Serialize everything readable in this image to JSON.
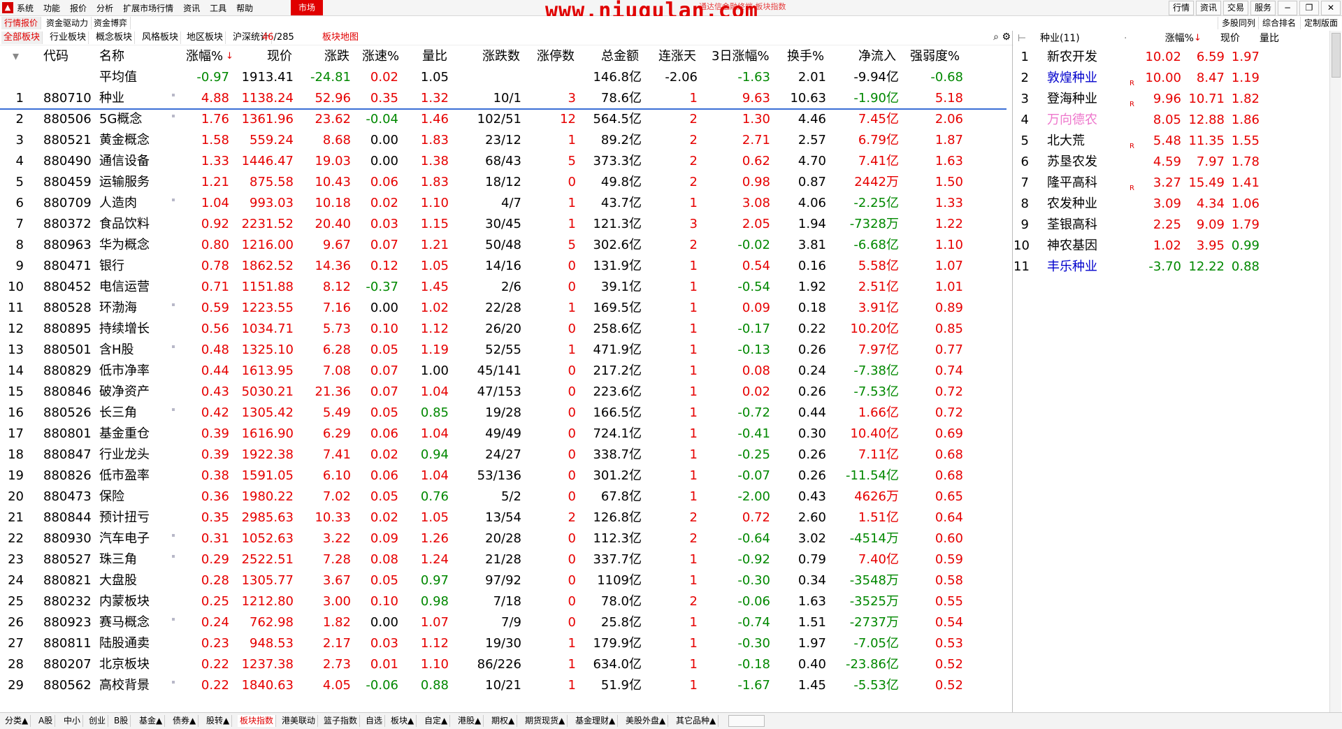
{
  "menubar": {
    "logo": "▲",
    "items": [
      "系统",
      "功能",
      "报价",
      "分析",
      "扩展市场行情",
      "资讯",
      "工具",
      "帮助"
    ],
    "market_button": "市场",
    "watermark": "www.niugulan.com",
    "watermark_sub": "通达信金融终端 板块指数",
    "right_items": [
      "行情",
      "资讯",
      "交易",
      "服务"
    ]
  },
  "tabs_top": [
    "行情报价",
    "资金驱动力",
    "资金博弈"
  ],
  "tabs_top_right": [
    "多股同列",
    "综合排名",
    "定制版面"
  ],
  "tabs_second": [
    "全部板块",
    "行业板块",
    "概念板块",
    "风格板块",
    "地区板块",
    "沪深统计"
  ],
  "counter": {
    "current": "46",
    "total": "/285"
  },
  "map_link": "板块地图",
  "main_table": {
    "headers": [
      "代码",
      "名称",
      "涨幅%",
      "现价",
      "涨跌",
      "涨速%",
      "量比",
      "涨跌数",
      "涨停数",
      "总金额",
      "连涨天",
      "3日涨幅%",
      "换手%",
      "净流入",
      "强弱度%"
    ],
    "average_row": {
      "label": "平均值",
      "chg_pct": "-0.97",
      "price": "1913.41",
      "chg": "-24.81",
      "speed": "0.02",
      "vol_ratio": "1.05",
      "amount": "146.8亿",
      "days": "-2.06",
      "three_day": "-1.63",
      "turnover": "2.01",
      "net_flow": "-9.94亿",
      "strength": "-0.68"
    },
    "rows": [
      {
        "idx": "1",
        "code": "880710",
        "name": "种业",
        "dot": true,
        "chg_pct": "4.88",
        "price": "1138.24",
        "chg": "52.96",
        "speed": "0.35",
        "vol_ratio": "1.32",
        "updown": "10/1",
        "limit": "3",
        "amount": "78.6亿",
        "days": "1",
        "three_day": "9.63",
        "turnover": "10.63",
        "net_flow": "-1.90亿",
        "strength": "5.18"
      },
      {
        "idx": "2",
        "code": "880506",
        "name": "5G概念",
        "dot": true,
        "chg_pct": "1.76",
        "price": "1361.96",
        "chg": "23.62",
        "speed": "-0.04",
        "vol_ratio": "1.46",
        "updown": "102/51",
        "limit": "12",
        "amount": "564.5亿",
        "days": "2",
        "three_day": "1.30",
        "turnover": "4.46",
        "net_flow": "7.45亿",
        "strength": "2.06"
      },
      {
        "idx": "3",
        "code": "880521",
        "name": "黄金概念",
        "dot": false,
        "chg_pct": "1.58",
        "price": "559.24",
        "chg": "8.68",
        "speed": "0.00",
        "vol_ratio": "1.83",
        "updown": "23/12",
        "limit": "1",
        "amount": "89.2亿",
        "days": "2",
        "three_day": "2.71",
        "turnover": "2.57",
        "net_flow": "6.79亿",
        "strength": "1.87"
      },
      {
        "idx": "4",
        "code": "880490",
        "name": "通信设备",
        "dot": false,
        "chg_pct": "1.33",
        "price": "1446.47",
        "chg": "19.03",
        "speed": "0.00",
        "vol_ratio": "1.38",
        "updown": "68/43",
        "limit": "5",
        "amount": "373.3亿",
        "days": "2",
        "three_day": "0.62",
        "turnover": "4.70",
        "net_flow": "7.41亿",
        "strength": "1.63"
      },
      {
        "idx": "5",
        "code": "880459",
        "name": "运输服务",
        "dot": false,
        "chg_pct": "1.21",
        "price": "875.58",
        "chg": "10.43",
        "speed": "0.06",
        "vol_ratio": "1.83",
        "updown": "18/12",
        "limit": "0",
        "amount": "49.8亿",
        "days": "2",
        "three_day": "0.98",
        "turnover": "0.87",
        "net_flow": "2442万",
        "strength": "1.50"
      },
      {
        "idx": "6",
        "code": "880709",
        "name": "人造肉",
        "dot": true,
        "chg_pct": "1.04",
        "price": "993.03",
        "chg": "10.18",
        "speed": "0.02",
        "vol_ratio": "1.10",
        "updown": "4/7",
        "limit": "1",
        "amount": "43.7亿",
        "days": "1",
        "three_day": "3.08",
        "turnover": "4.06",
        "net_flow": "-2.25亿",
        "strength": "1.33"
      },
      {
        "idx": "7",
        "code": "880372",
        "name": "食品饮料",
        "dot": false,
        "chg_pct": "0.92",
        "price": "2231.52",
        "chg": "20.40",
        "speed": "0.03",
        "vol_ratio": "1.15",
        "updown": "30/45",
        "limit": "1",
        "amount": "121.3亿",
        "days": "3",
        "three_day": "2.05",
        "turnover": "1.94",
        "net_flow": "-7328万",
        "strength": "1.22"
      },
      {
        "idx": "8",
        "code": "880963",
        "name": "华为概念",
        "dot": false,
        "chg_pct": "0.80",
        "price": "1216.00",
        "chg": "9.67",
        "speed": "0.07",
        "vol_ratio": "1.21",
        "updown": "50/48",
        "limit": "5",
        "amount": "302.6亿",
        "days": "2",
        "three_day": "-0.02",
        "turnover": "3.81",
        "net_flow": "-6.68亿",
        "strength": "1.10"
      },
      {
        "idx": "9",
        "code": "880471",
        "name": "银行",
        "dot": false,
        "chg_pct": "0.78",
        "price": "1862.52",
        "chg": "14.36",
        "speed": "0.12",
        "vol_ratio": "1.05",
        "updown": "14/16",
        "limit": "0",
        "amount": "131.9亿",
        "days": "1",
        "three_day": "0.54",
        "turnover": "0.16",
        "net_flow": "5.58亿",
        "strength": "1.07"
      },
      {
        "idx": "10",
        "code": "880452",
        "name": "电信运营",
        "dot": false,
        "chg_pct": "0.71",
        "price": "1151.88",
        "chg": "8.12",
        "speed": "-0.37",
        "vol_ratio": "1.45",
        "updown": "2/6",
        "limit": "0",
        "amount": "39.1亿",
        "days": "1",
        "three_day": "-0.54",
        "turnover": "1.92",
        "net_flow": "2.51亿",
        "strength": "1.01"
      },
      {
        "idx": "11",
        "code": "880528",
        "name": "环渤海",
        "dot": true,
        "chg_pct": "0.59",
        "price": "1223.55",
        "chg": "7.16",
        "speed": "0.00",
        "vol_ratio": "1.02",
        "updown": "22/28",
        "limit": "1",
        "amount": "169.5亿",
        "days": "1",
        "three_day": "0.09",
        "turnover": "0.18",
        "net_flow": "3.91亿",
        "strength": "0.89"
      },
      {
        "idx": "12",
        "code": "880895",
        "name": "持续增长",
        "dot": false,
        "chg_pct": "0.56",
        "price": "1034.71",
        "chg": "5.73",
        "speed": "0.10",
        "vol_ratio": "1.12",
        "updown": "26/20",
        "limit": "0",
        "amount": "258.6亿",
        "days": "1",
        "three_day": "-0.17",
        "turnover": "0.22",
        "net_flow": "10.20亿",
        "strength": "0.85"
      },
      {
        "idx": "13",
        "code": "880501",
        "name": "含H股",
        "dot": true,
        "chg_pct": "0.48",
        "price": "1325.10",
        "chg": "6.28",
        "speed": "0.05",
        "vol_ratio": "1.19",
        "updown": "52/55",
        "limit": "1",
        "amount": "471.9亿",
        "days": "1",
        "three_day": "-0.13",
        "turnover": "0.26",
        "net_flow": "7.97亿",
        "strength": "0.77"
      },
      {
        "idx": "14",
        "code": "880829",
        "name": "低市净率",
        "dot": false,
        "chg_pct": "0.44",
        "price": "1613.95",
        "chg": "7.08",
        "speed": "0.07",
        "vol_ratio": "1.00",
        "updown": "45/141",
        "limit": "0",
        "amount": "217.2亿",
        "days": "1",
        "three_day": "0.08",
        "turnover": "0.24",
        "net_flow": "-7.38亿",
        "strength": "0.74"
      },
      {
        "idx": "15",
        "code": "880846",
        "name": "破净资产",
        "dot": false,
        "chg_pct": "0.43",
        "price": "5030.21",
        "chg": "21.36",
        "speed": "0.07",
        "vol_ratio": "1.04",
        "updown": "47/153",
        "limit": "0",
        "amount": "223.6亿",
        "days": "1",
        "three_day": "0.02",
        "turnover": "0.26",
        "net_flow": "-7.53亿",
        "strength": "0.72"
      },
      {
        "idx": "16",
        "code": "880526",
        "name": "长三角",
        "dot": true,
        "chg_pct": "0.42",
        "price": "1305.42",
        "chg": "5.49",
        "speed": "0.05",
        "vol_ratio": "0.85",
        "updown": "19/28",
        "limit": "0",
        "amount": "166.5亿",
        "days": "1",
        "three_day": "-0.72",
        "turnover": "0.44",
        "net_flow": "1.66亿",
        "strength": "0.72"
      },
      {
        "idx": "17",
        "code": "880801",
        "name": "基金重仓",
        "dot": false,
        "chg_pct": "0.39",
        "price": "1616.90",
        "chg": "6.29",
        "speed": "0.06",
        "vol_ratio": "1.04",
        "updown": "49/49",
        "limit": "0",
        "amount": "724.1亿",
        "days": "1",
        "three_day": "-0.41",
        "turnover": "0.30",
        "net_flow": "10.40亿",
        "strength": "0.69"
      },
      {
        "idx": "18",
        "code": "880847",
        "name": "行业龙头",
        "dot": false,
        "chg_pct": "0.39",
        "price": "1922.38",
        "chg": "7.41",
        "speed": "0.02",
        "vol_ratio": "0.94",
        "updown": "24/27",
        "limit": "0",
        "amount": "338.7亿",
        "days": "1",
        "three_day": "-0.25",
        "turnover": "0.26",
        "net_flow": "7.11亿",
        "strength": "0.68"
      },
      {
        "idx": "19",
        "code": "880826",
        "name": "低市盈率",
        "dot": false,
        "chg_pct": "0.38",
        "price": "1591.05",
        "chg": "6.10",
        "speed": "0.06",
        "vol_ratio": "1.04",
        "updown": "53/136",
        "limit": "0",
        "amount": "301.2亿",
        "days": "1",
        "three_day": "-0.07",
        "turnover": "0.26",
        "net_flow": "-11.54亿",
        "strength": "0.68"
      },
      {
        "idx": "20",
        "code": "880473",
        "name": "保险",
        "dot": false,
        "chg_pct": "0.36",
        "price": "1980.22",
        "chg": "7.02",
        "speed": "0.05",
        "vol_ratio": "0.76",
        "updown": "5/2",
        "limit": "0",
        "amount": "67.8亿",
        "days": "1",
        "three_day": "-2.00",
        "turnover": "0.43",
        "net_flow": "4626万",
        "strength": "0.65"
      },
      {
        "idx": "21",
        "code": "880844",
        "name": "预计扭亏",
        "dot": false,
        "chg_pct": "0.35",
        "price": "2985.63",
        "chg": "10.33",
        "speed": "0.02",
        "vol_ratio": "1.05",
        "updown": "13/54",
        "limit": "2",
        "amount": "126.8亿",
        "days": "2",
        "three_day": "0.72",
        "turnover": "2.60",
        "net_flow": "1.51亿",
        "strength": "0.64"
      },
      {
        "idx": "22",
        "code": "880930",
        "name": "汽车电子",
        "dot": true,
        "chg_pct": "0.31",
        "price": "1052.63",
        "chg": "3.22",
        "speed": "0.09",
        "vol_ratio": "1.26",
        "updown": "20/28",
        "limit": "0",
        "amount": "112.3亿",
        "days": "2",
        "three_day": "-0.64",
        "turnover": "3.02",
        "net_flow": "-4514万",
        "strength": "0.60"
      },
      {
        "idx": "23",
        "code": "880527",
        "name": "珠三角",
        "dot": true,
        "chg_pct": "0.29",
        "price": "2522.51",
        "chg": "7.28",
        "speed": "0.08",
        "vol_ratio": "1.24",
        "updown": "21/28",
        "limit": "0",
        "amount": "337.7亿",
        "days": "1",
        "three_day": "-0.92",
        "turnover": "0.79",
        "net_flow": "7.40亿",
        "strength": "0.59"
      },
      {
        "idx": "24",
        "code": "880821",
        "name": "大盘股",
        "dot": false,
        "chg_pct": "0.28",
        "price": "1305.77",
        "chg": "3.67",
        "speed": "0.05",
        "vol_ratio": "0.97",
        "updown": "97/92",
        "limit": "0",
        "amount": "1109亿",
        "days": "1",
        "three_day": "-0.30",
        "turnover": "0.34",
        "net_flow": "-3548万",
        "strength": "0.58"
      },
      {
        "idx": "25",
        "code": "880232",
        "name": "内蒙板块",
        "dot": false,
        "chg_pct": "0.25",
        "price": "1212.80",
        "chg": "3.00",
        "speed": "0.10",
        "vol_ratio": "0.98",
        "updown": "7/18",
        "limit": "0",
        "amount": "78.0亿",
        "days": "2",
        "three_day": "-0.06",
        "turnover": "1.63",
        "net_flow": "-3525万",
        "strength": "0.55"
      },
      {
        "idx": "26",
        "code": "880923",
        "name": "赛马概念",
        "dot": true,
        "chg_pct": "0.24",
        "price": "762.98",
        "chg": "1.82",
        "speed": "0.00",
        "vol_ratio": "1.07",
        "updown": "7/9",
        "limit": "0",
        "amount": "25.8亿",
        "days": "1",
        "three_day": "-0.74",
        "turnover": "1.51",
        "net_flow": "-2737万",
        "strength": "0.54"
      },
      {
        "idx": "27",
        "code": "880811",
        "name": "陆股通卖",
        "dot": false,
        "chg_pct": "0.23",
        "price": "948.53",
        "chg": "2.17",
        "speed": "0.03",
        "vol_ratio": "1.12",
        "updown": "19/30",
        "limit": "1",
        "amount": "179.9亿",
        "days": "1",
        "three_day": "-0.30",
        "turnover": "1.97",
        "net_flow": "-7.05亿",
        "strength": "0.53"
      },
      {
        "idx": "28",
        "code": "880207",
        "name": "北京板块",
        "dot": false,
        "chg_pct": "0.22",
        "price": "1237.38",
        "chg": "2.73",
        "speed": "0.01",
        "vol_ratio": "1.10",
        "updown": "86/226",
        "limit": "1",
        "amount": "634.0亿",
        "days": "1",
        "three_day": "-0.18",
        "turnover": "0.40",
        "net_flow": "-23.86亿",
        "strength": "0.52"
      },
      {
        "idx": "29",
        "code": "880562",
        "name": "高校背景",
        "dot": true,
        "chg_pct": "0.22",
        "price": "1840.63",
        "chg": "4.05",
        "speed": "-0.06",
        "vol_ratio": "0.88",
        "updown": "10/21",
        "limit": "1",
        "amount": "51.9亿",
        "days": "1",
        "three_day": "-1.67",
        "turnover": "1.45",
        "net_flow": "-5.53亿",
        "strength": "0.52"
      }
    ]
  },
  "side_panel": {
    "title": "种业(11)",
    "headers": [
      "涨幅%",
      "现价",
      "量比"
    ],
    "rows": [
      {
        "idx": "1",
        "name": "新农开发",
        "color": "black",
        "badge": "",
        "chg": "10.02",
        "price": "6.59",
        "vol": "1.97"
      },
      {
        "idx": "2",
        "name": "敦煌种业",
        "color": "blue",
        "badge": "R",
        "chg": "10.00",
        "price": "8.47",
        "vol": "1.19"
      },
      {
        "idx": "3",
        "name": "登海种业",
        "color": "black",
        "badge": "R",
        "chg": "9.96",
        "price": "10.71",
        "vol": "1.82"
      },
      {
        "idx": "4",
        "name": "万向德农",
        "color": "pink",
        "badge": "",
        "chg": "8.05",
        "price": "12.88",
        "vol": "1.86"
      },
      {
        "idx": "5",
        "name": "北大荒",
        "color": "black",
        "badge": "R",
        "chg": "5.48",
        "price": "11.35",
        "vol": "1.55"
      },
      {
        "idx": "6",
        "name": "苏垦农发",
        "color": "black",
        "badge": "",
        "chg": "4.59",
        "price": "7.97",
        "vol": "1.78"
      },
      {
        "idx": "7",
        "name": "隆平高科",
        "color": "black",
        "badge": "R",
        "chg": "3.27",
        "price": "15.49",
        "vol": "1.41"
      },
      {
        "idx": "8",
        "name": "农发种业",
        "color": "black",
        "badge": "",
        "chg": "3.09",
        "price": "4.34",
        "vol": "1.06"
      },
      {
        "idx": "9",
        "name": "荃银高科",
        "color": "black",
        "badge": "",
        "chg": "2.25",
        "price": "9.09",
        "vol": "1.79"
      },
      {
        "idx": "10",
        "name": "神农基因",
        "color": "black",
        "badge": "",
        "chg": "1.02",
        "price": "3.95",
        "vol": "0.99"
      },
      {
        "idx": "11",
        "name": "丰乐种业",
        "color": "blue",
        "badge": "",
        "chg": "-3.70",
        "price": "12.22",
        "vol": "0.88"
      }
    ]
  },
  "bottom_tabs": [
    "分类▲",
    "A股",
    "中小",
    "创业",
    "B股",
    "基金▲",
    "债券▲",
    "股转▲",
    "板块指数",
    "港美联动",
    "篮子指数",
    "自选",
    "板块▲",
    "自定▲",
    "港股▲",
    "期权▲",
    "期货现货▲",
    "基金理财▲",
    "美股外盘▲",
    "其它品种▲"
  ],
  "bottom_active_index": 8,
  "colors": {
    "up": "#e60000",
    "down": "#008800",
    "accent": "#e00000"
  }
}
